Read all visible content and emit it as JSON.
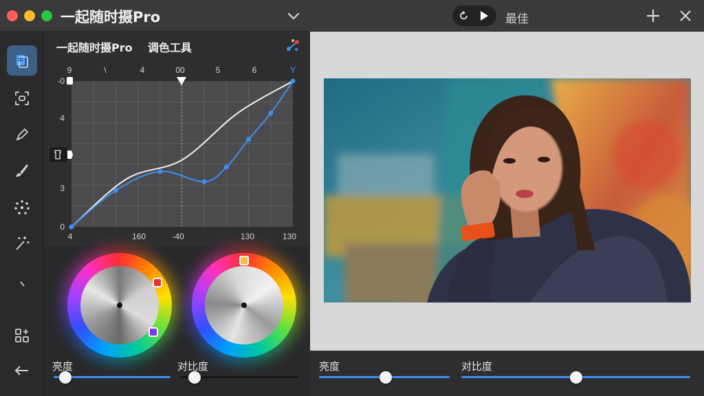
{
  "window": {
    "title": "一起随时摄Pro",
    "toolbar_label": "最佳",
    "traffic_colors": [
      "#ff5f57",
      "#febc2e",
      "#28c840"
    ]
  },
  "sidebar": {
    "tools": [
      {
        "icon": "photos-icon",
        "active": true
      },
      {
        "icon": "scan-frame-icon",
        "active": false
      },
      {
        "icon": "pen-icon",
        "active": false
      },
      {
        "icon": "brush-icon",
        "active": false
      },
      {
        "icon": "selection-dots-icon",
        "active": false
      },
      {
        "icon": "magic-wand-icon",
        "active": false
      },
      {
        "icon": "slash-icon",
        "active": false
      },
      {
        "icon": "apps-grid-icon",
        "active": false
      },
      {
        "icon": "back-arrow-icon",
        "active": false
      }
    ]
  },
  "curves": {
    "title": "一起随时摄Pro    调色工具",
    "top_ticks": [
      "9",
      "\\",
      "4",
      "00",
      "5",
      "6",
      "Y"
    ],
    "left_ticks": [
      "-0",
      "4",
      "3",
      "0"
    ],
    "bottom_ticks": [
      "4",
      "160",
      "-40",
      "130",
      "130"
    ],
    "chart_data": {
      "type": "line",
      "series": [
        {
          "values": [
            [
              0,
              0
            ],
            [
              0.2,
              0.25
            ],
            [
              0.4,
              0.38
            ],
            [
              0.6,
              0.31
            ],
            [
              0.7,
              0.41
            ],
            [
              0.8,
              0.6
            ],
            [
              0.9,
              0.78
            ],
            [
              1.0,
              1.0
            ]
          ]
        },
        {
          "values": [
            [
              0,
              0
            ],
            [
              0.25,
              0.33
            ],
            [
              0.5,
              0.46
            ],
            [
              0.75,
              0.78
            ],
            [
              1.0,
              1.0
            ]
          ]
        }
      ],
      "colors": {
        "points_curve": "#3d8ff0",
        "reference_curve": "#f2f2f2"
      }
    }
  },
  "wheels": {
    "left": {
      "handle_color": "#e83030"
    },
    "right": {
      "handle_color": "#f0c040"
    }
  },
  "left_sliders": {
    "brightness_label": "亮度",
    "contrast_label": "对比度",
    "brightness_value": 0.1,
    "contrast_value": 0.12
  },
  "bottom_sliders": {
    "brightness_label": "亮度",
    "contrast_label": "对比度",
    "brightness_value": 0.51,
    "contrast_value": 0.5
  },
  "colors": {
    "accent": "#3d8ff0",
    "active_tool": "#3d5f86"
  }
}
